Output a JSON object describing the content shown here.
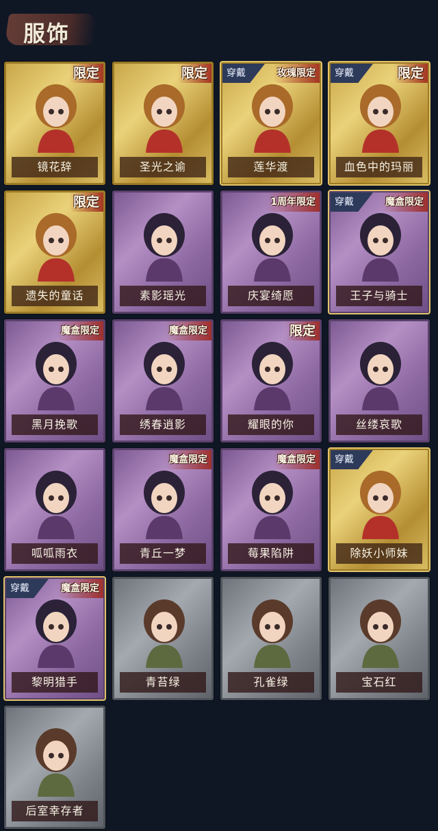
{
  "section": {
    "title": "服饰"
  },
  "items": [
    {
      "name": "镜花辞",
      "rarity": "gold",
      "tag": "限定",
      "equipped": false,
      "equip_label": ""
    },
    {
      "name": "圣光之谕",
      "rarity": "gold",
      "tag": "限定",
      "equipped": false,
      "equip_label": ""
    },
    {
      "name": "莲华渡",
      "rarity": "gold",
      "tag": "玫瑰限定",
      "equipped": true,
      "equip_label": "穿戴"
    },
    {
      "name": "血色中的玛丽",
      "rarity": "gold",
      "tag": "限定",
      "equipped": true,
      "equip_label": "穿戴"
    },
    {
      "name": "遗失的童话",
      "rarity": "gold",
      "tag": "限定",
      "equipped": false,
      "equip_label": ""
    },
    {
      "name": "素影瑶光",
      "rarity": "purple",
      "tag": "",
      "equipped": false,
      "equip_label": ""
    },
    {
      "name": "庆宴绮愿",
      "rarity": "purple",
      "tag": "1周年限定",
      "equipped": false,
      "equip_label": ""
    },
    {
      "name": "王子与骑士",
      "rarity": "purple",
      "tag": "魔盒限定",
      "equipped": true,
      "equip_label": "穿戴"
    },
    {
      "name": "黑月挽歌",
      "rarity": "purple",
      "tag": "魔盒限定",
      "equipped": false,
      "equip_label": ""
    },
    {
      "name": "绣春逍影",
      "rarity": "purple",
      "tag": "魔盒限定",
      "equipped": false,
      "equip_label": ""
    },
    {
      "name": "耀眼的你",
      "rarity": "purple",
      "tag": "限定",
      "equipped": false,
      "equip_label": ""
    },
    {
      "name": "丝缕哀歌",
      "rarity": "purple",
      "tag": "",
      "equipped": false,
      "equip_label": ""
    },
    {
      "name": "呱呱雨衣",
      "rarity": "purple",
      "tag": "",
      "equipped": false,
      "equip_label": ""
    },
    {
      "name": "青丘一梦",
      "rarity": "purple",
      "tag": "魔盒限定",
      "equipped": false,
      "equip_label": ""
    },
    {
      "name": "莓果陷阱",
      "rarity": "purple",
      "tag": "魔盒限定",
      "equipped": false,
      "equip_label": ""
    },
    {
      "name": "除妖小师妹",
      "rarity": "gold",
      "tag": "",
      "equipped": true,
      "equip_label": "穿戴"
    },
    {
      "name": "黎明猎手",
      "rarity": "purple",
      "tag": "魔盒限定",
      "equipped": true,
      "equip_label": "穿戴"
    },
    {
      "name": "青苔绿",
      "rarity": "gray",
      "tag": "",
      "equipped": false,
      "equip_label": ""
    },
    {
      "name": "孔雀绿",
      "rarity": "gray",
      "tag": "",
      "equipped": false,
      "equip_label": ""
    },
    {
      "name": "宝石红",
      "rarity": "gray",
      "tag": "",
      "equipped": false,
      "equip_label": ""
    },
    {
      "name": "后室幸存者",
      "rarity": "gray",
      "tag": "",
      "equipped": false,
      "equip_label": ""
    }
  ],
  "colors": {
    "background": "#0f1725",
    "gold_frame": "#c9a74a",
    "purple_frame": "#8f6aa3",
    "gray_frame": "#7d8289",
    "tag_red": "#a0281e",
    "equip_badge": "#2d3a5a"
  },
  "icons": {
    "portrait": "character-portrait-icon",
    "equip": "equipped-badge-icon",
    "tag": "limited-tag-icon"
  }
}
